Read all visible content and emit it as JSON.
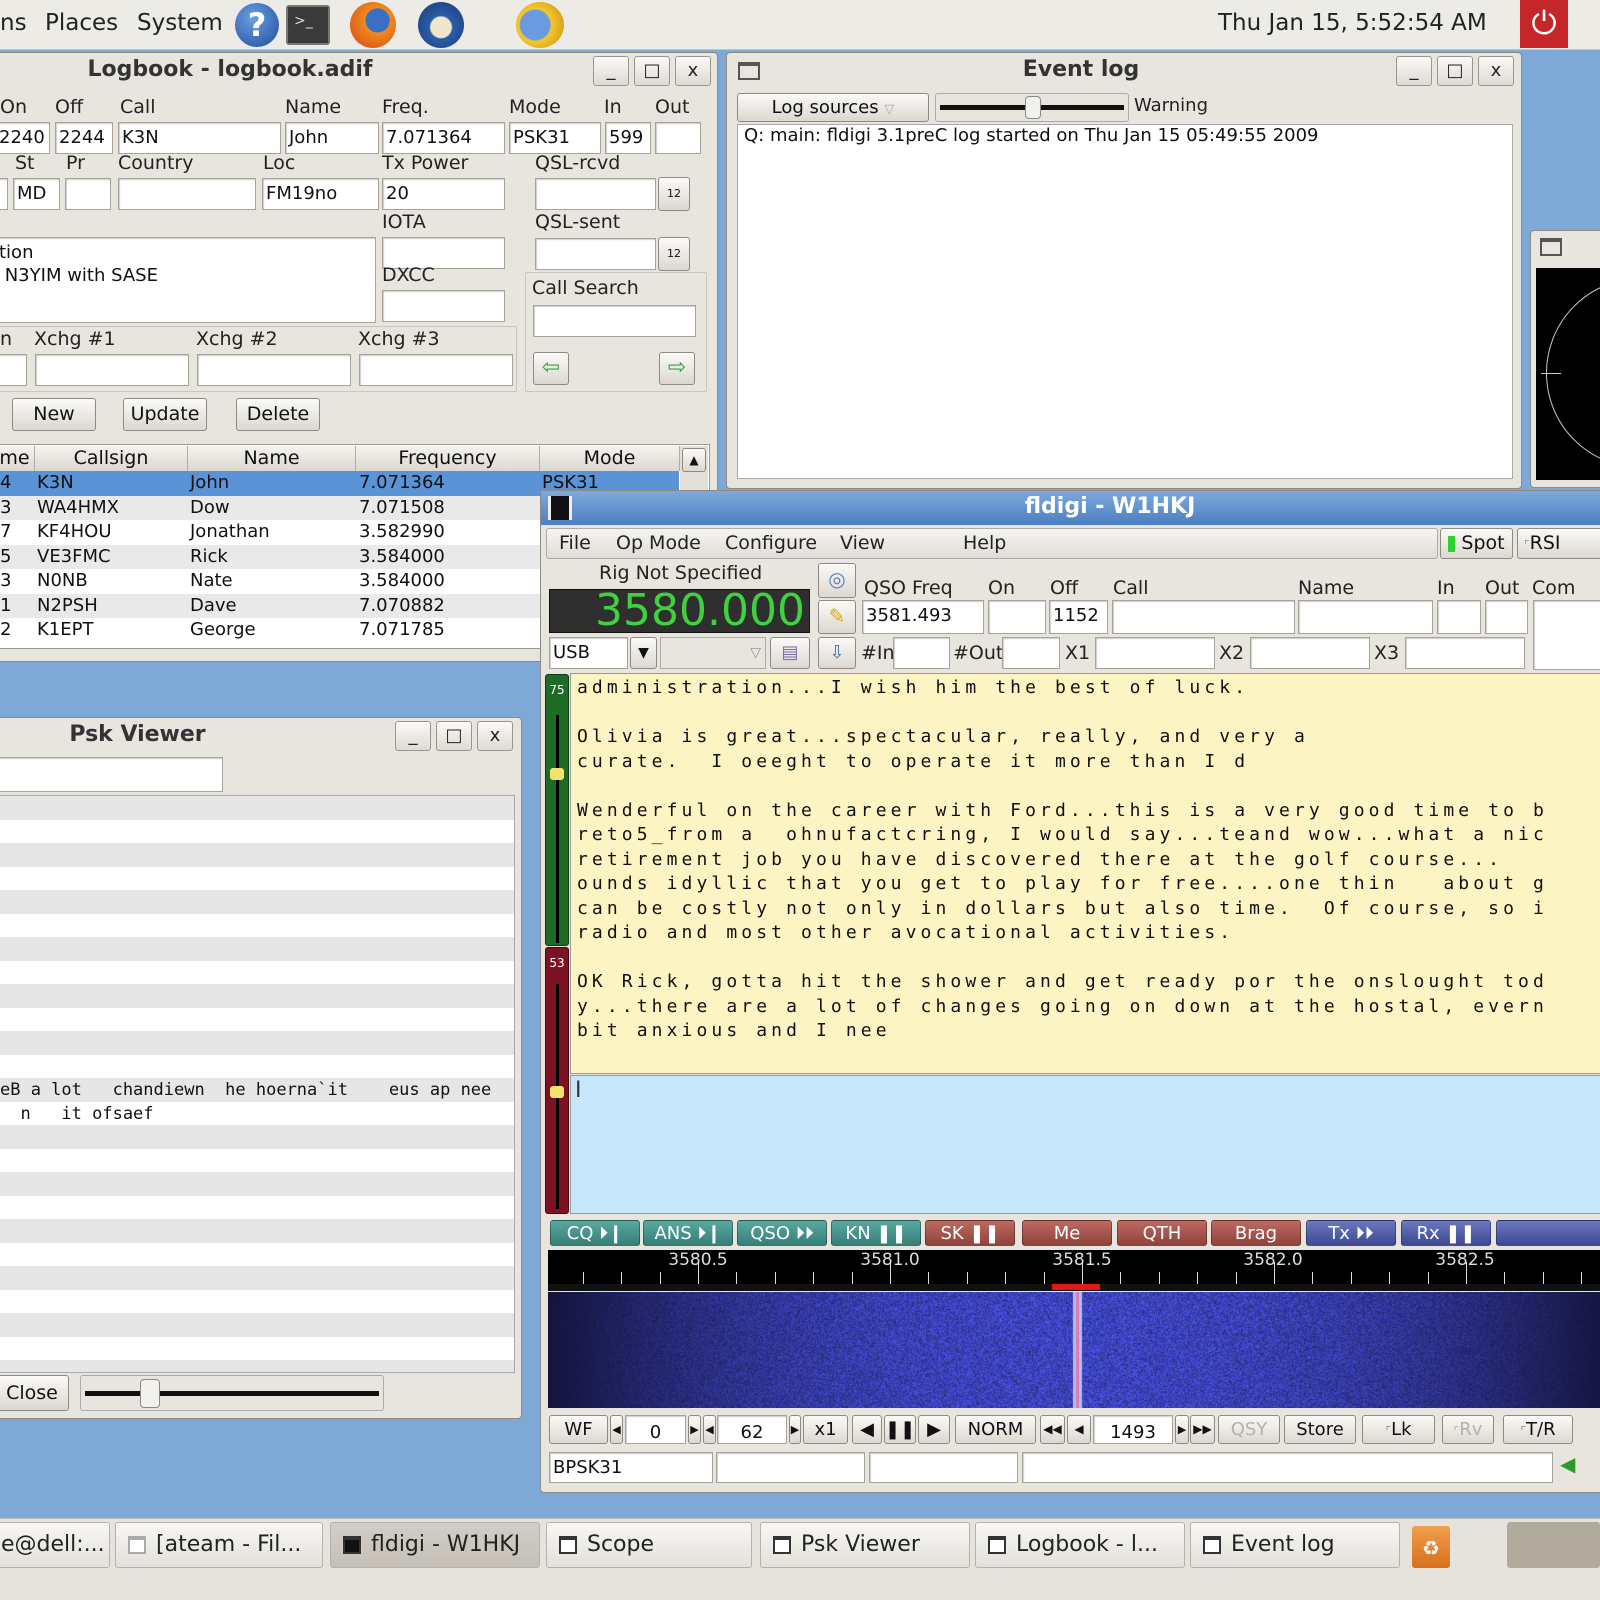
{
  "top_panel": {
    "menus": [
      "ns",
      "Places",
      "System"
    ],
    "launchers": [
      "help-icon",
      "terminal-icon",
      "firefox-icon",
      "thunderbird-icon",
      "browser-icon"
    ],
    "clock": "Thu Jan 15,  5:52:54 AM",
    "power_icon": "power-icon"
  },
  "logbook": {
    "title": "Logbook - logbook.adif",
    "controls": {
      "minimize": "_",
      "maximize": "□",
      "close": "x"
    },
    "labels": {
      "on": "On",
      "off": "Off",
      "call": "Call",
      "name": "Name",
      "freq": "Freq.",
      "mode": "Mode",
      "in": "In",
      "out": "Out",
      "st": "St",
      "pr": "Pr",
      "country": "Country",
      "loc": "Loc",
      "txpower": "Tx Power",
      "qsl_rcvd": "QSL-rcvd",
      "iota": "IOTA",
      "qsl_sent": "QSL-sent",
      "dxcc": "DXCC",
      "call_search": "Call Search",
      "xchg_n": "n",
      "xchg1": "Xchg #1",
      "xchg2": "Xchg #2",
      "xchg3": "Xchg #3"
    },
    "values": {
      "on": "2240",
      "off": "2244",
      "call": "K3N",
      "name": "John",
      "freq": "7.071364",
      "mode": "PSK31",
      "in": "599",
      "out": "",
      "st": "MD",
      "pr": "",
      "country": "",
      "loc": "FM19no",
      "txpower": "20",
      "qsl_rcvd": "",
      "iota": "",
      "qsl_sent": "",
      "dxcc": "",
      "notes_line1": "tion",
      "notes_line2": " N3YIM with SASE",
      "call_search": "",
      "xchg1": "",
      "xchg2": "",
      "xchg3": ""
    },
    "buttons": {
      "new": "New",
      "update": "Update",
      "delete": "Delete"
    },
    "table": {
      "columns": [
        "me",
        "Callsign",
        "Name",
        "Frequency",
        "Mode"
      ],
      "rows": [
        {
          "c0": "4",
          "call": "K3N",
          "name": "John",
          "freq": "7.071364",
          "mode": "PSK31",
          "selected": true
        },
        {
          "c0": "3",
          "call": "WA4HMX",
          "name": "Dow",
          "freq": "7.071508",
          "mode": ""
        },
        {
          "c0": "7",
          "call": "KF4HOU",
          "name": "Jonathan",
          "freq": "3.582990",
          "mode": ""
        },
        {
          "c0": "5",
          "call": "VE3FMC",
          "name": "Rick",
          "freq": "3.584000",
          "mode": ""
        },
        {
          "c0": "3",
          "call": "N0NB",
          "name": "Nate",
          "freq": "3.584000",
          "mode": ""
        },
        {
          "c0": "1",
          "call": "N2PSH",
          "name": "Dave",
          "freq": "7.070882",
          "mode": ""
        },
        {
          "c0": "2",
          "call": "K1EPT",
          "name": "George",
          "freq": "7.071785",
          "mode": ""
        }
      ]
    }
  },
  "event_log": {
    "title": "Event log",
    "log_sources": "Log sources",
    "level": "Warning",
    "level_slider_fraction": 0.5,
    "text": "Q: main: fldigi 3.1preC log started on Thu Jan 15 05:49:55 2009"
  },
  "psk_viewer": {
    "title": "Psk Viewer",
    "search_value": "",
    "lines": [
      "eB a lot   chandiewn  he hoerna`it    eus ap nee",
      "  n   it ofsaef"
    ],
    "close": "Close",
    "slider_fraction": 0.2
  },
  "fldigi": {
    "title": "fldigi - W1HKJ",
    "menu": [
      "File",
      "Op Mode",
      "Configure",
      "View",
      "Help"
    ],
    "spot": "Spot",
    "rsid": "RSI",
    "rig": "Rig Not Specified",
    "frequency": "3580.000",
    "mode_combo": "USB",
    "qso_labels": {
      "qso_freq": "QSO Freq",
      "on": "On",
      "off": "Off",
      "call": "Call",
      "name": "Name",
      "in": "In",
      "out": "Out",
      "com": "Com",
      "n_in": "#In",
      "n_out": "#Out",
      "x1": "X1",
      "x2": "X2",
      "x3": "X3"
    },
    "qso_values": {
      "qso_freq": "3581.493",
      "on": "",
      "off": "1152",
      "call": "",
      "name": "",
      "in": "",
      "out": ""
    },
    "rx_text": [
      "administration...I wish him the best of luck.",
      "",
      "Olivia is great...spectacular, really, and very a",
      "curate.  I oeeght to operate it more than I d",
      "",
      "Wenderful on the career with Ford...this is a very good time to b",
      "reto5_from a  ohnufactcring, I would say...teand wow...what a nic",
      "retirement job you have discovered there at the golf course...",
      "ounds idyllic that you get to play for free....one thin   about g",
      "can be costly not only in dollars but also time.  Of course, so i",
      "radio and most other avocational activities.",
      "",
      "OK Rick, gotta hit the shower and get ready por the onslought tod",
      "y...there are a lot of changes going on down at the hostal, evern",
      "bit anxious and I nee"
    ],
    "squelch_upper": "75",
    "squelch_lower": "53",
    "macros": [
      {
        "label": "CQ ⏵❙",
        "color": "teal"
      },
      {
        "label": "ANS ⏵❙",
        "color": "teal"
      },
      {
        "label": "QSO ⏵⏵",
        "color": "teal"
      },
      {
        "label": "KN ❚❚",
        "color": "teal"
      },
      {
        "label": "SK ❚❚",
        "color": "red"
      },
      {
        "label": "Me",
        "color": "red"
      },
      {
        "label": "QTH",
        "color": "red"
      },
      {
        "label": "Brag",
        "color": "red"
      },
      {
        "label": "Tx ⏵⏵",
        "color": "blue"
      },
      {
        "label": "Rx ❚❚",
        "color": "blue"
      },
      {
        "label": "",
        "color": "blue"
      }
    ],
    "ruler_ticks": [
      "3580.5",
      "3581.0",
      "3581.5",
      "3582.0",
      "3582.5"
    ],
    "controls": {
      "wf": "WF",
      "offset": "0",
      "range": "62",
      "zoom": "x1",
      "norm": "NORM",
      "carrier": "1493",
      "qsy": "QSY",
      "store": "Store",
      "lk": "Lk",
      "rv": "Rv",
      "tr": "T/R"
    },
    "status": {
      "mode": "BPSK31",
      "s2": "",
      "s3": "",
      "s4": ""
    },
    "colors": {
      "freq_display": "#3fd13f",
      "rx_bg": "#fdf4c4",
      "tx_bg": "#c6e6fb"
    }
  },
  "taskbar": {
    "items": [
      "e@dell:...",
      "[ateam - Fil...",
      "fldigi - W1HKJ",
      "Scope",
      "Psk Viewer",
      "Logbook - l...",
      "Event log"
    ],
    "active": "fldigi - W1HKJ"
  }
}
